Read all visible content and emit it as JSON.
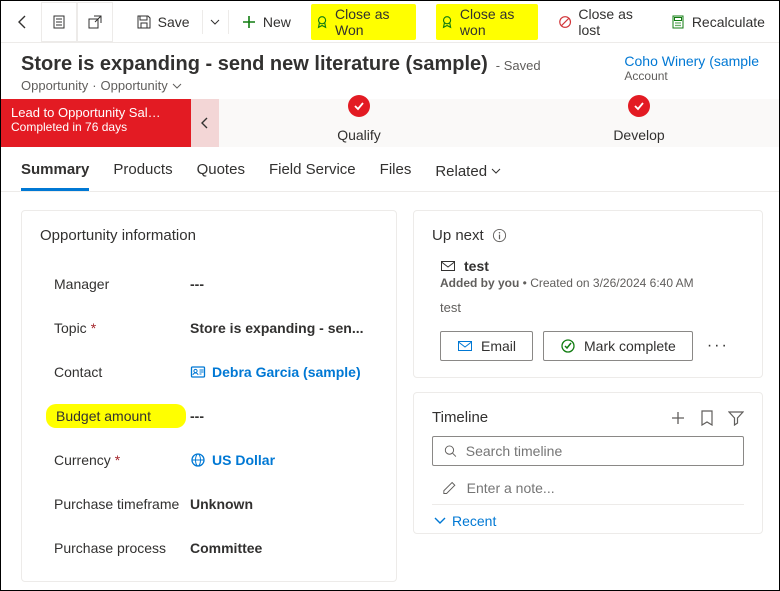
{
  "toolbar": {
    "save": "Save",
    "new": "New",
    "close_won_1": "Close as Won",
    "close_won_2": "Close as won",
    "close_lost": "Close as lost",
    "recalculate": "Recalculate"
  },
  "header": {
    "title": "Store is expanding - send new literature (sample)",
    "saved": "- Saved",
    "crumb1": "Opportunity",
    "crumb2": "Opportunity",
    "account_link": "Coho Winery (sample",
    "account_sub": "Account"
  },
  "stages": {
    "lead_title": "Lead to Opportunity Sal…",
    "lead_sub": "Completed in 76 days",
    "qualify": "Qualify",
    "develop": "Develop"
  },
  "tabs": {
    "summary": "Summary",
    "products": "Products",
    "quotes": "Quotes",
    "field_service": "Field Service",
    "files": "Files",
    "related": "Related"
  },
  "opp_info": {
    "title": "Opportunity information",
    "fields": {
      "manager_label": "Manager",
      "manager_value": "---",
      "topic_label": "Topic",
      "topic_value": "Store is expanding - sen...",
      "contact_label": "Contact",
      "contact_value": "Debra Garcia (sample)",
      "budget_label": "Budget amount",
      "budget_value": "---",
      "currency_label": "Currency",
      "currency_value": "US Dollar",
      "timeframe_label": "Purchase timeframe",
      "timeframe_value": "Unknown",
      "process_label": "Purchase process",
      "process_value": "Committee"
    }
  },
  "upnext": {
    "title": "Up next",
    "activity_title": "test",
    "added_by": "Added by you",
    "created": "Created on 3/26/2024 6:40 AM",
    "body": "test",
    "email": "Email",
    "complete": "Mark complete"
  },
  "timeline": {
    "title": "Timeline",
    "search_placeholder": "Search timeline",
    "note_placeholder": "Enter a note...",
    "recent": "Recent"
  }
}
